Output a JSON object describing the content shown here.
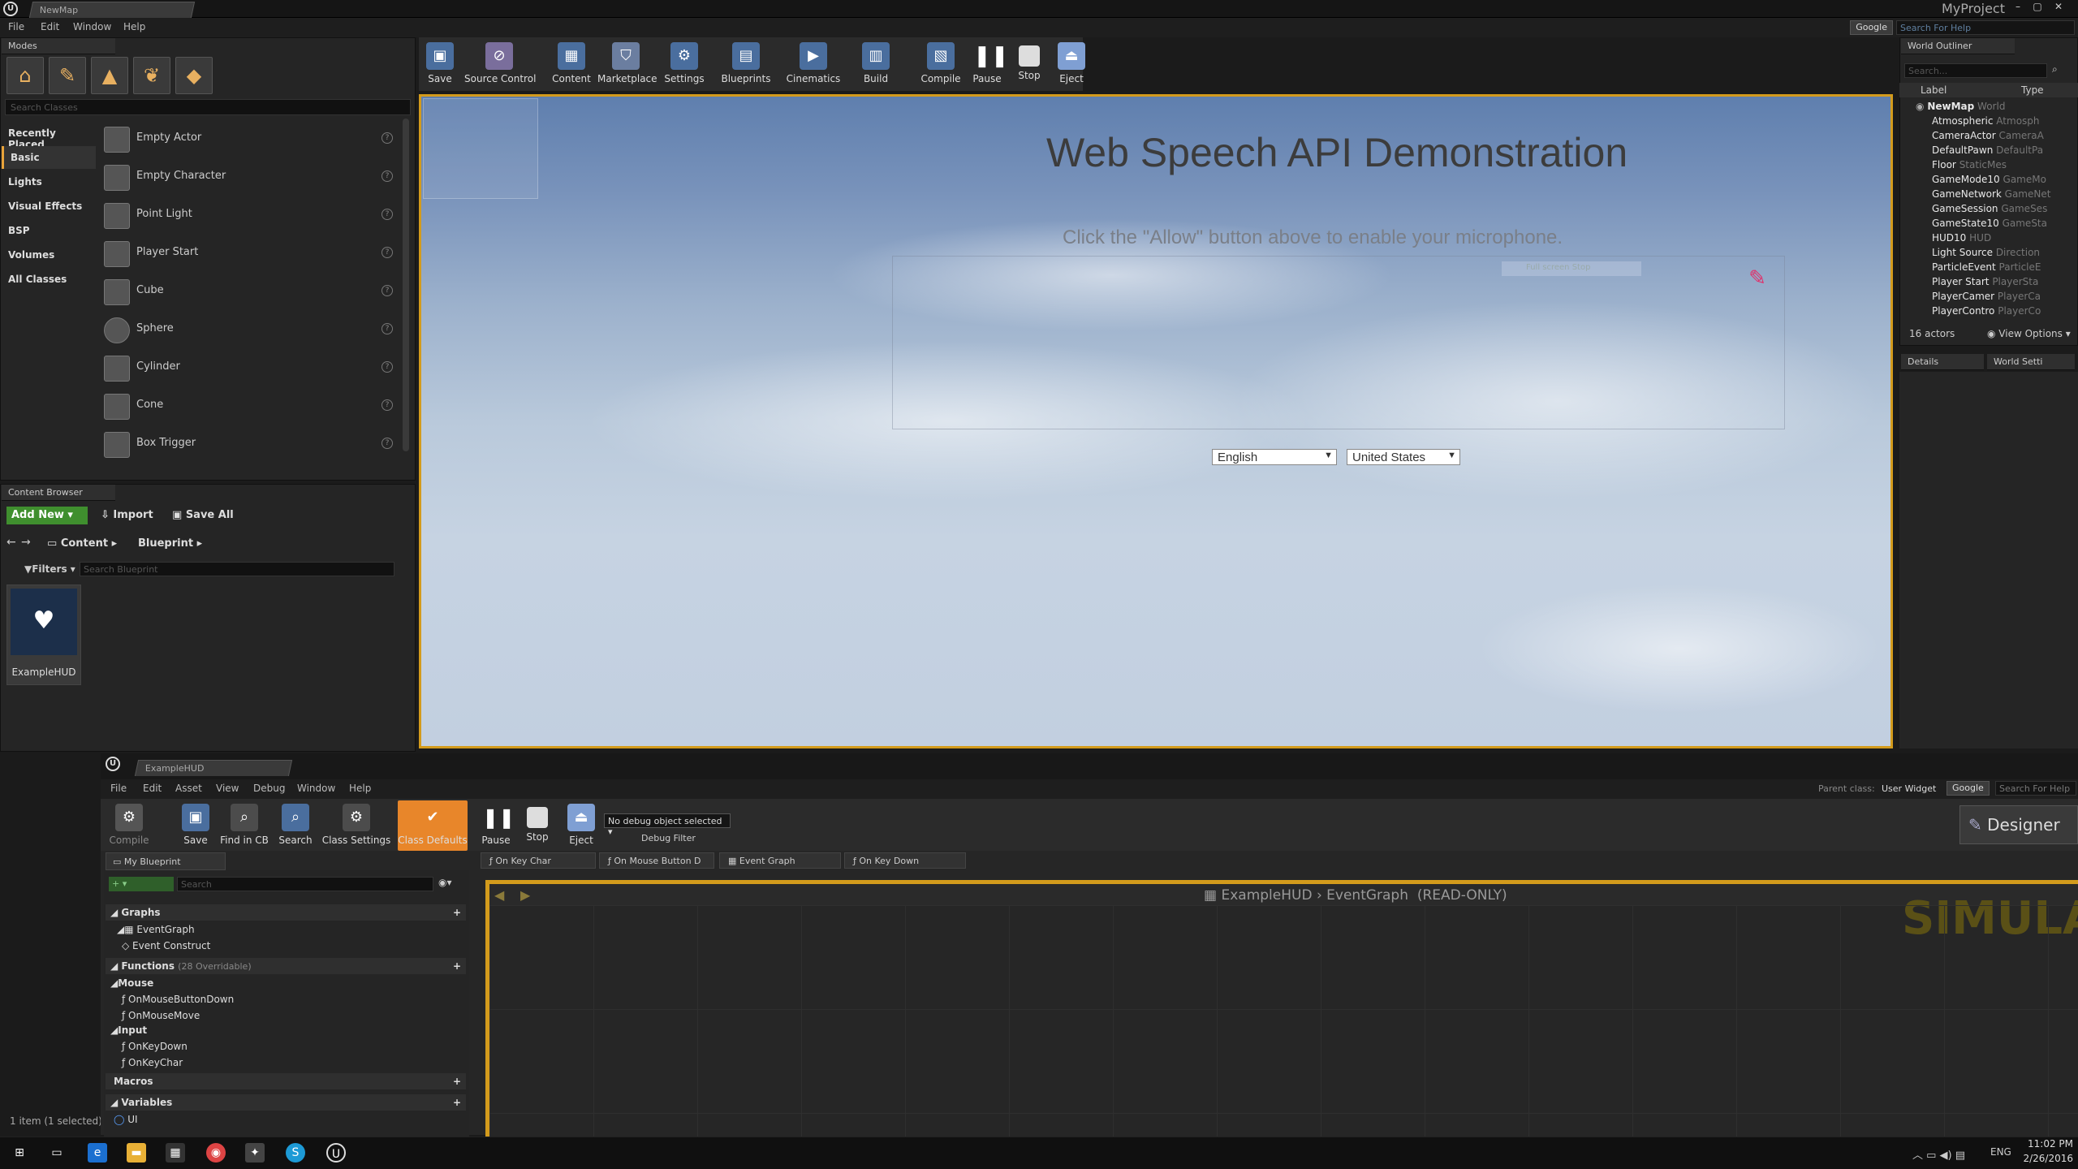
{
  "window": {
    "doc_tab": "NewMap",
    "project_name": "MyProject",
    "menu": [
      "File",
      "Edit",
      "Window",
      "Help"
    ],
    "google_label": "Google",
    "help_placeholder": "Search For Help"
  },
  "modes": {
    "tab_label": "Modes",
    "search_placeholder": "Search Classes",
    "categories": [
      "Recently Placed",
      "Basic",
      "Lights",
      "Visual Effects",
      "BSP",
      "Volumes",
      "All Classes"
    ],
    "active_category": "Basic",
    "items": [
      "Empty Actor",
      "Empty Character",
      "Point Light",
      "Player Start",
      "Cube",
      "Sphere",
      "Cylinder",
      "Cone",
      "Box Trigger"
    ]
  },
  "toolbar": {
    "buttons": [
      {
        "label": "Save",
        "icon": "save-icon"
      },
      {
        "label": "Source Control",
        "icon": "source-control-icon"
      },
      {
        "label": "Content",
        "icon": "content-icon"
      },
      {
        "label": "Marketplace",
        "icon": "marketplace-icon"
      },
      {
        "label": "Settings",
        "icon": "settings-icon"
      },
      {
        "label": "Blueprints",
        "icon": "blueprints-icon"
      },
      {
        "label": "Cinematics",
        "icon": "cinematics-icon"
      },
      {
        "label": "Build",
        "icon": "build-icon"
      },
      {
        "label": "Compile",
        "icon": "compile-icon"
      },
      {
        "label": "Pause",
        "icon": "pause-icon"
      },
      {
        "label": "Stop",
        "icon": "stop-icon"
      },
      {
        "label": "Eject",
        "icon": "eject-icon"
      }
    ]
  },
  "viewport": {
    "title": "Web Speech API Demonstration",
    "info": "Click the \"Allow\" button above to enable your microphone.",
    "inner_label": "Full screen Stop",
    "language": "English",
    "dialect": "United States"
  },
  "outliner": {
    "tab_label": "World Outliner",
    "search_placeholder": "Search...",
    "col_label": "Label",
    "col_type": "Type",
    "rows": [
      {
        "label": "NewMap",
        "type": "World"
      },
      {
        "label": "Atmospheric",
        "type": "Atmosph"
      },
      {
        "label": "CameraActor",
        "type": "CameraA"
      },
      {
        "label": "DefaultPawn",
        "type": "DefaultPa"
      },
      {
        "label": "Floor",
        "type": "StaticMes"
      },
      {
        "label": "GameMode10",
        "type": "GameMo"
      },
      {
        "label": "GameNetwork",
        "type": "GameNet"
      },
      {
        "label": "GameSession",
        "type": "GameSes"
      },
      {
        "label": "GameState10",
        "type": "GameSta"
      },
      {
        "label": "HUD10",
        "type": "HUD"
      },
      {
        "label": "Light Source",
        "type": "Direction"
      },
      {
        "label": "ParticleEvent",
        "type": "ParticleE"
      },
      {
        "label": "Player Start",
        "type": "PlayerSta"
      },
      {
        "label": "PlayerCamer",
        "type": "PlayerCa"
      },
      {
        "label": "PlayerContro",
        "type": "PlayerCo"
      }
    ],
    "actor_count": "16 actors",
    "view_options": "View Options",
    "details_tab": "Details",
    "world_settings_tab": "World Setti"
  },
  "content_browser": {
    "tab_label": "Content Browser",
    "add_new": "Add New",
    "import": "Import",
    "save_all": "Save All",
    "path": [
      "Content",
      "Blueprint"
    ],
    "filters": "Filters",
    "search_placeholder": "Search Blueprint",
    "asset_name": "ExampleHUD",
    "status": "1 item (1 selected)"
  },
  "blueprint": {
    "doc_tab": "ExampleHUD",
    "menu": [
      "File",
      "Edit",
      "Asset",
      "View",
      "Debug",
      "Window",
      "Help"
    ],
    "parent_class_label": "Parent class:",
    "parent_class": "User Widget",
    "google_label": "Google",
    "help_placeholder": "Search For Help",
    "toolbar": [
      "Compile",
      "Save",
      "Find in CB",
      "Search",
      "Class Settings",
      "Class Defaults",
      "Pause",
      "Stop",
      "Eject"
    ],
    "debug_object": "No debug object selected",
    "debug_filter": "Debug Filter",
    "designer": "Designer",
    "my_blueprint": "My Blueprint",
    "search_placeholder": "Search",
    "graph_tabs": [
      "On Key Char",
      "On Mouse Button D",
      "Event Graph",
      "On Key Down"
    ],
    "tree": {
      "graphs": "Graphs",
      "event_graph": "EventGraph",
      "event_construct": "Event Construct",
      "functions": "Functions",
      "functions_count": "(28 Overridable)",
      "mouse": "Mouse",
      "on_mouse_button_down": "OnMouseButtonDown",
      "on_mouse_move": "OnMouseMove",
      "input": "Input",
      "on_key_down": "OnKeyDown",
      "on_key_char": "OnKeyChar",
      "macros": "Macros",
      "variables": "Variables",
      "var_ui": "UI"
    },
    "breadcrumb_root": "ExampleHUD",
    "breadcrumb_graph": "EventGraph",
    "readonly": "(READ-ONLY)",
    "watermark": "SIMULAT"
  },
  "taskbar": {
    "time": "11:02 PM",
    "date": "2/26/2016",
    "lang": "ENG"
  }
}
